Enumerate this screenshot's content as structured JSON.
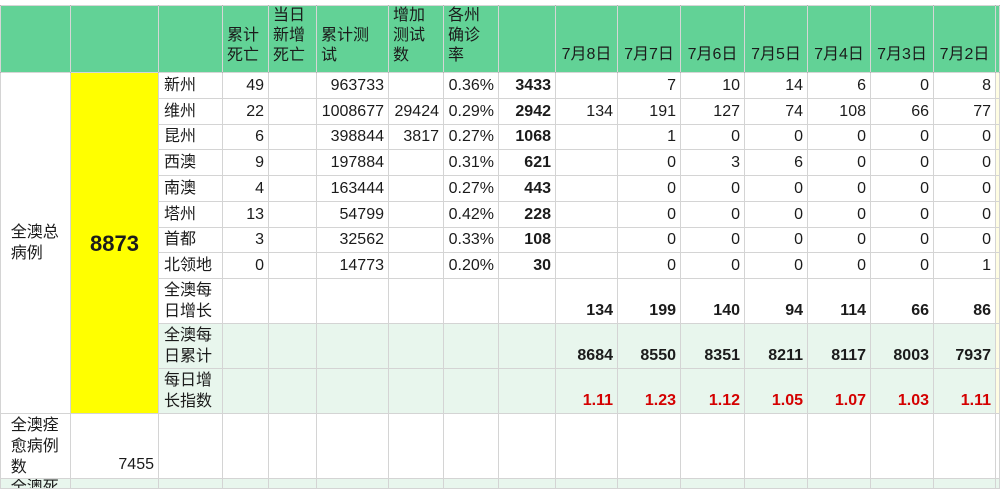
{
  "columns": {
    "cumulative_deaths": "累计死亡",
    "new_deaths": "当日新增死亡",
    "cumulative_tests": "累计测试",
    "new_tests": "增加测试数",
    "state_rate": "各州确诊率",
    "dates": [
      "7月8日",
      "7月7日",
      "7月6日",
      "7月5日",
      "7月4日",
      "7月3日",
      "7月2日"
    ]
  },
  "total": {
    "label": "全澳总病例",
    "value": "8873"
  },
  "states": [
    {
      "name": "新州",
      "deaths": "49",
      "new_deaths": "",
      "tests": "963733",
      "new_tests": "",
      "rate": "0.36%",
      "confirmed": "3433",
      "daily": [
        "",
        "7",
        "10",
        "14",
        "6",
        "0",
        "8"
      ]
    },
    {
      "name": "维州",
      "deaths": "22",
      "new_deaths": "",
      "tests": "1008677",
      "new_tests": "29424",
      "rate": "0.29%",
      "confirmed": "2942",
      "daily": [
        "134",
        "191",
        "127",
        "74",
        "108",
        "66",
        "77"
      ]
    },
    {
      "name": "昆州",
      "deaths": "6",
      "new_deaths": "",
      "tests": "398844",
      "new_tests": "3817",
      "rate": "0.27%",
      "confirmed": "1068",
      "daily": [
        "",
        "1",
        "0",
        "0",
        "0",
        "0",
        "0"
      ]
    },
    {
      "name": "西澳",
      "deaths": "9",
      "new_deaths": "",
      "tests": "197884",
      "new_tests": "",
      "rate": "0.31%",
      "confirmed": "621",
      "daily": [
        "",
        "0",
        "3",
        "6",
        "0",
        "0",
        "0"
      ]
    },
    {
      "name": "南澳",
      "deaths": "4",
      "new_deaths": "",
      "tests": "163444",
      "new_tests": "",
      "rate": "0.27%",
      "confirmed": "443",
      "daily": [
        "",
        "0",
        "0",
        "0",
        "0",
        "0",
        "0"
      ]
    },
    {
      "name": "塔州",
      "deaths": "13",
      "new_deaths": "",
      "tests": "54799",
      "new_tests": "",
      "rate": "0.42%",
      "confirmed": "228",
      "daily": [
        "",
        "0",
        "0",
        "0",
        "0",
        "0",
        "0"
      ]
    },
    {
      "name": "首都",
      "deaths": "3",
      "new_deaths": "",
      "tests": "32562",
      "new_tests": "",
      "rate": "0.33%",
      "confirmed": "108",
      "daily": [
        "",
        "0",
        "0",
        "0",
        "0",
        "0",
        "0"
      ]
    },
    {
      "name": "北领地",
      "deaths": "0",
      "new_deaths": "",
      "tests": "14773",
      "new_tests": "",
      "rate": "0.20%",
      "confirmed": "30",
      "daily": [
        "",
        "0",
        "0",
        "0",
        "0",
        "0",
        "1"
      ]
    }
  ],
  "summary": [
    {
      "label": "全澳每日增长",
      "values": [
        "134",
        "199",
        "140",
        "94",
        "114",
        "66",
        "86"
      ]
    },
    {
      "label": "全澳每日累计",
      "values": [
        "8684",
        "8550",
        "8351",
        "8211",
        "8117",
        "8003",
        "7937"
      ]
    },
    {
      "label": "每日增长指数",
      "values": [
        "1.11",
        "1.23",
        "1.12",
        "1.05",
        "1.07",
        "1.03",
        "1.11"
      ]
    }
  ],
  "recovered": {
    "label": "全澳痊愈病例数",
    "value": "7455"
  },
  "deaths_total": {
    "label": "全澳死"
  },
  "colors": {
    "header_bg": "#62D296",
    "highlight_yellow": "#FFFF00",
    "summary_bg": "#E8F6ED",
    "index_red": "#D40000",
    "grid": "#D4D4D4"
  }
}
